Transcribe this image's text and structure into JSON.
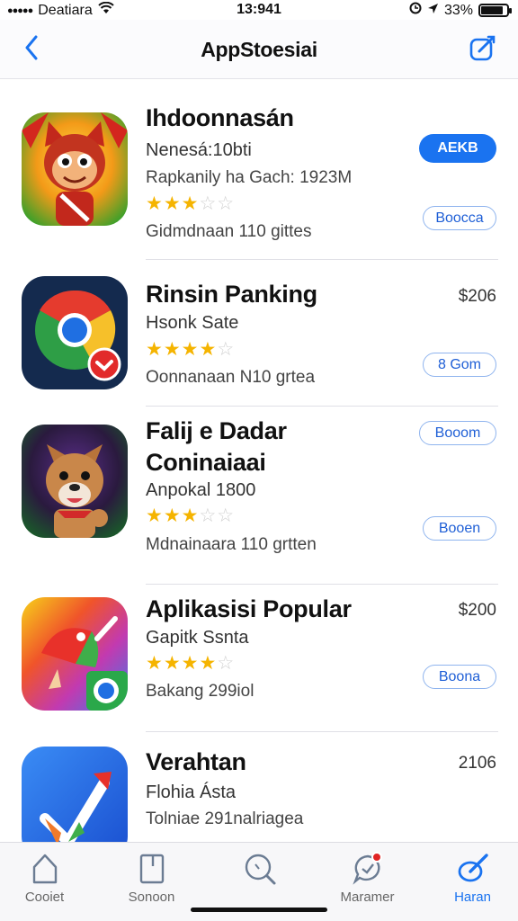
{
  "status_bar": {
    "signal": "●●●●●",
    "carrier": "Deatiara",
    "time": "13:941",
    "battery_text": "33%",
    "battery_level": 0.85
  },
  "nav": {
    "title": "AppStoesiai",
    "back_icon": "chevron-left-icon",
    "compose_icon": "compose-icon",
    "accent": "#1a73f0"
  },
  "apps": [
    {
      "name": "Ihdoonnasán",
      "subtitle": "Nenesá:10bti",
      "meta": "Rapkanily ha Gach: 1923M",
      "rating": 3,
      "rating_stars": "★★★",
      "rating_empty": "☆☆",
      "reviews": "Gidmdnaan 110 gittes",
      "action_label": "AEKB",
      "secondary_label": "Boocca",
      "icon": "monkey-game-icon"
    },
    {
      "name": "Rinsin Panking",
      "subtitle": "Hsonk Sate",
      "reviews": "Oonnanaan N10 grtea",
      "rating": 3.5,
      "rating_stars": "★★★★",
      "rating_empty": "☆",
      "price": "$206",
      "secondary_label": "8 Gom",
      "icon": "chrome-browser-icon"
    },
    {
      "name": "Falij e Dadar",
      "name_line2": "Coninaiaai",
      "subtitle": "Anpokal 1800",
      "reviews": "Mdnainaara 110 grtten",
      "rating": 3,
      "rating_stars": "★★★",
      "rating_empty": "☆☆",
      "top_label": "Booom",
      "secondary_label": "Booen",
      "icon": "fox-game-icon"
    },
    {
      "name": "Aplikasisi Popular",
      "subtitle": "Gapitk Ssnta",
      "meta": "Bakang 299iol",
      "rating": 4,
      "rating_stars": "★★★★",
      "rating_empty": "☆",
      "price": "$200",
      "secondary_label": "Boona",
      "icon": "color-bird-icon"
    },
    {
      "name": "Verahtan",
      "subtitle": "Flohia Ásta",
      "meta": "Tolniae 291nalriagea",
      "price": "2106",
      "icon": "arrow-app-icon"
    }
  ],
  "tabs": [
    {
      "label": "Cooiet",
      "icon": "home-icon"
    },
    {
      "label": "Sonoon",
      "icon": "document-icon"
    },
    {
      "label": "",
      "icon": "search-icon"
    },
    {
      "label": "Maramer",
      "icon": "chat-icon"
    },
    {
      "label": "Haran",
      "icon": "pen-icon"
    }
  ]
}
